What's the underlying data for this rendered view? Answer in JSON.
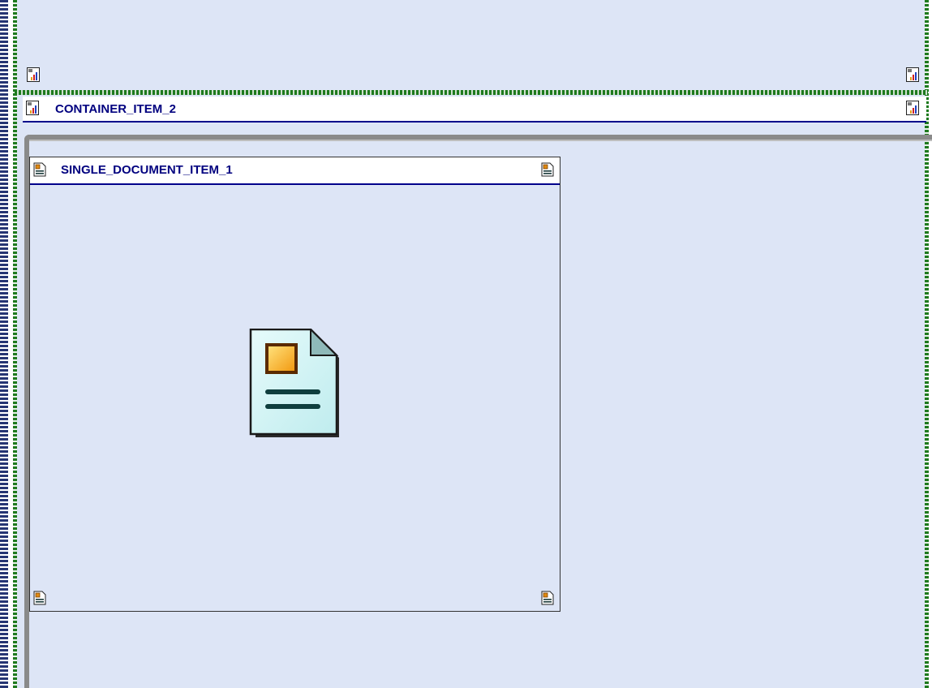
{
  "container": {
    "title": "CONTAINER_ITEM_2",
    "icon": "container-icon"
  },
  "document": {
    "title": "SINGLE_DOCUMENT_ITEM_1",
    "icon": "document-icon"
  },
  "colors": {
    "background": "#dde5f6",
    "title_text": "#00007f",
    "title_underline": "#00008b",
    "dashed_green": "#1e7a1e",
    "dashed_blue": "#1a2a6c"
  }
}
